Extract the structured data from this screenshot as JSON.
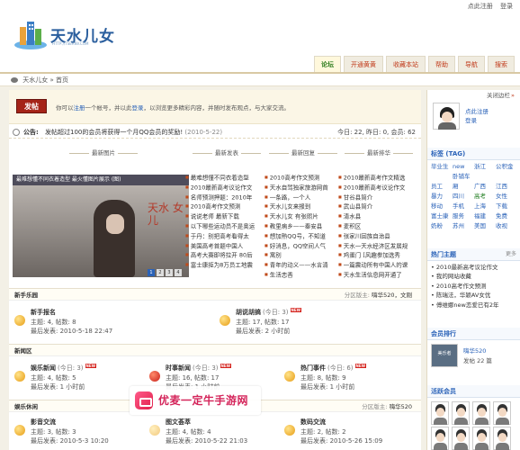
{
  "header": {
    "logo_text": "天水儿女",
    "logo_sub": "HTTP://TSERNV.COM",
    "top_links": [
      "点此注册",
      "登录"
    ]
  },
  "nav": {
    "tabs": [
      {
        "label": "论坛",
        "active": true
      },
      {
        "label": "开通黄黄",
        "active": false
      },
      {
        "label": "收藏本站",
        "active": false
      },
      {
        "label": "帮助",
        "active": false
      },
      {
        "label": "导航",
        "active": false
      },
      {
        "label": "搜索",
        "active": false
      }
    ]
  },
  "breadcrumb": {
    "site": "天水儿女",
    "sep": "»",
    "page": "首页"
  },
  "postbar": {
    "button": "发帖",
    "welcome_pre": "你可以",
    "welcome_reg": "注册",
    "welcome_mid": "一个帐号，并以此",
    "welcome_login": "登录",
    "welcome_post": "，以浏览更多精彩内容，并随时发布观点，与大家交流。"
  },
  "notice": {
    "label": "公告:",
    "text": "发帖超过100的会员将获得一个月QQ会员的奖励!",
    "date": "(2010-5-22)",
    "stats": "今日: 22, 昨日: 0, 会员: 62"
  },
  "blocks": {
    "col_heads": [
      "最新图片",
      "最新发表",
      "最新回复",
      "最新排华"
    ],
    "photo_caption": "最难想懂不同衣着造型 最火懂图片展示 (图)",
    "photo_callig": "天水 女 儿",
    "photo_pages": [
      "1",
      "2",
      "3",
      "4"
    ],
    "latest_posts": [
      "最难想懂不同衣着造型",
      "2010最新高考议论作文",
      "名师预测押题：2010年",
      "2010高考作文预测",
      "说说老师 最新下载",
      "以下哪些运动员不是奥运",
      "于丹：别把高考看得太",
      "美国高考首题中国人",
      "高考大赛即将拉开 80后",
      "富士康拒为8万员工地震"
    ],
    "latest_replies": [
      "2010高考作文预测",
      "天水自驾独家旅游网首",
      "一条路，一个人",
      "天水儿女来报到",
      "天水儿女 有张照片",
      "教里病乡——秦安县",
      "想加熟QQ号，不知道",
      "好消息，QQ空间人气",
      "寓别",
      "青年的动义——水言清",
      "生活恋香"
    ],
    "latest_hot": [
      "2010最新高考作文精选",
      "2010最新高考议论作文",
      "甘谷县简介",
      "武山县简介",
      "清水县",
      "麦积区",
      "张家川回族自治县",
      "天水一天水经济区发展规",
      "鸡蛋门 [风趣参加选秀",
      "一篇震动所有中国人的课",
      "天水生活信息网开通了"
    ]
  },
  "sections": [
    {
      "title": "新手乐园",
      "moderator_label": "分区版主:",
      "moderator": "嗨华520，文刚",
      "forums": [
        {
          "name": "新手报名",
          "today": "",
          "new": false,
          "threads": "主题: 4, 帖数: 8",
          "last": "最后发表: 2010-5-18 22:47",
          "icon": "yellow"
        },
        {
          "name": "胡说胡搞",
          "today": "(今日: 3)",
          "new": true,
          "threads": "主题: 17, 帖数: 17",
          "last": "最后发表: 2 小时前",
          "icon": "yellow"
        }
      ]
    },
    {
      "title": "新闻区",
      "moderator_label": "",
      "moderator": "",
      "forums": [
        {
          "name": "娱乐新闻",
          "today": "(今日: 3)",
          "new": true,
          "threads": "主题: 4, 帖数: 5",
          "last": "最后发表: 1 小时前",
          "icon": "yellow"
        },
        {
          "name": "时事新闻",
          "today": "(今日: 3)",
          "new": true,
          "threads": "主题: 16, 帖数: 17",
          "last": "最后发表: 1 小时前",
          "icon": "red"
        },
        {
          "name": "热门事件",
          "today": "(今日: 6)",
          "new": true,
          "threads": "主题: 8, 帖数: 9",
          "last": "最后发表: 1 小时前",
          "icon": "yellow"
        }
      ]
    },
    {
      "title": "娱乐休闲",
      "moderator_label": "分区版主:",
      "moderator": "嗨华520",
      "forums": [
        {
          "name": "影音交流",
          "today": "",
          "new": false,
          "threads": "主题: 3, 帖数: 3",
          "last": "最后发表: 2010-5-3 10:20",
          "icon": "yellow"
        },
        {
          "name": "图文荟萃",
          "today": "",
          "new": false,
          "threads": "主题: 4, 帖数: 4",
          "last": "最后发表: 2010-5-22 21:03",
          "icon": "yellow"
        },
        {
          "name": "数码交流",
          "today": "",
          "new": false,
          "threads": "主题: 2, 帖数: 2",
          "last": "最后发表: 2010-5-26 15:09",
          "icon": "yellow"
        }
      ]
    }
  ],
  "sidebar": {
    "close": "关闭边栏",
    "register": "点此注册",
    "login": "登录",
    "tags_title": "标签 (TAG)",
    "tags": [
      {
        "t": "毕业生",
        "hot": false
      },
      {
        "t": "new",
        "hot": false
      },
      {
        "t": "浙江",
        "hot": false
      },
      {
        "t": "公积金",
        "hot": false
      },
      {
        "t": "员工",
        "hot": false
      },
      {
        "t": "卧铺车厢",
        "hot": false
      },
      {
        "t": "广西",
        "hot": false
      },
      {
        "t": "江西",
        "hot": false
      },
      {
        "t": "暴力",
        "hot": false
      },
      {
        "t": "四川",
        "hot": false
      },
      {
        "t": "高考",
        "hot": true
      },
      {
        "t": "女性",
        "hot": false
      },
      {
        "t": "移动",
        "hot": false
      },
      {
        "t": "手机",
        "hot": false
      },
      {
        "t": "上海",
        "hot": false
      },
      {
        "t": "下载",
        "hot": false
      },
      {
        "t": "富士康",
        "hot": false
      },
      {
        "t": "服务",
        "hot": false
      },
      {
        "t": "福建",
        "hot": false
      },
      {
        "t": "免费",
        "hot": false
      },
      {
        "t": "奶粉",
        "hot": false
      },
      {
        "t": "苏州",
        "hot": false
      },
      {
        "t": "美国",
        "hot": false
      },
      {
        "t": "收视",
        "hot": false
      }
    ],
    "hot_title": "热门主题",
    "hot_more": "更多",
    "hot": [
      "2010最新高考议论作文",
      "我的网站收藏",
      "2010高考作文预测",
      "陈瑞法，华颖AV女优",
      "傅维娜new恋爱已有2年"
    ],
    "member_title": "会员排行",
    "member_name": "嗨华520",
    "member_posts": "发帖",
    "member_count": "22 篇",
    "member_avatar_label": "美乐者",
    "active_title": "活跃会员"
  },
  "watermark": {
    "text": "优麦一定牛手游网"
  }
}
